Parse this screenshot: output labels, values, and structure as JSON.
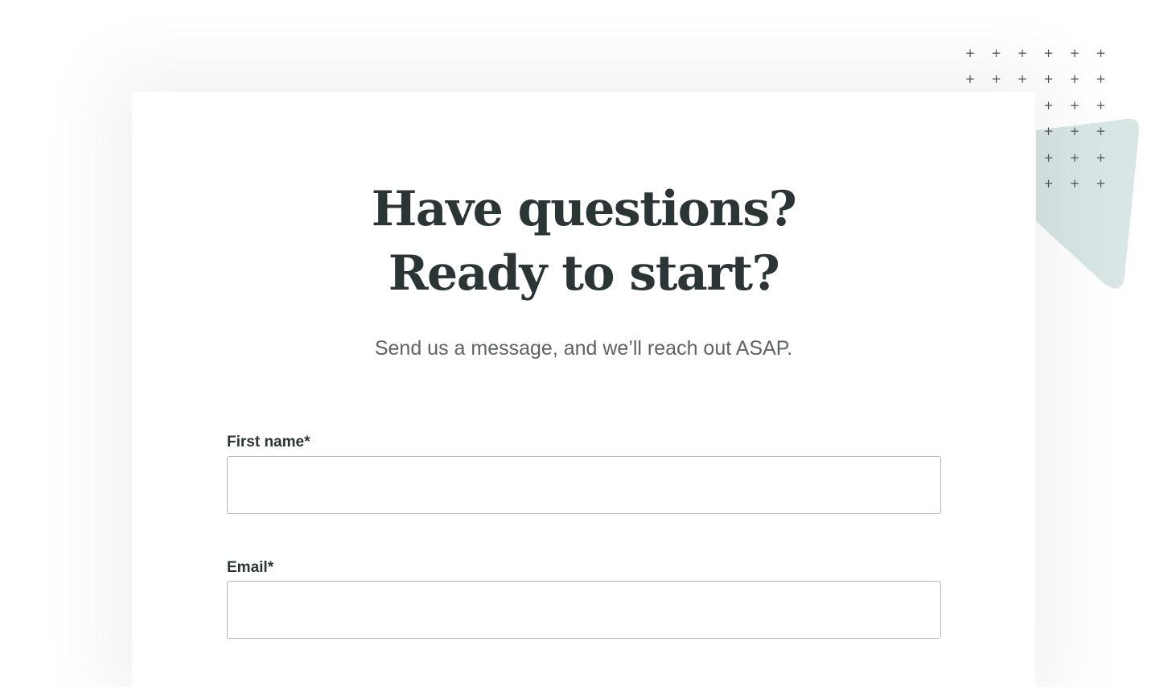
{
  "decoration": {
    "accent_color": "#d8e6e5",
    "plus_glyph": "+",
    "plus_rows": [
      [
        1,
        1,
        1,
        1,
        1,
        1
      ],
      [
        1,
        1,
        1,
        1,
        1,
        1
      ],
      [
        0,
        0,
        0,
        1,
        1,
        1
      ],
      [
        0,
        0,
        0,
        1,
        1,
        1
      ],
      [
        0,
        0,
        0,
        1,
        1,
        1
      ],
      [
        0,
        0,
        0,
        1,
        1,
        1
      ]
    ]
  },
  "contact_form": {
    "heading_line1": "Have questions?",
    "heading_line2": "Ready to start?",
    "subheading": "Send us a message, and we’ll reach out ASAP.",
    "fields": {
      "first_name": {
        "label": "First name*",
        "value": "",
        "placeholder": ""
      },
      "email": {
        "label": "Email*",
        "value": "",
        "placeholder": ""
      }
    }
  },
  "colors": {
    "heading": "#2b3535",
    "body_text": "#5d6462",
    "input_border": "#b3b8b6",
    "background": "#ffffff"
  }
}
